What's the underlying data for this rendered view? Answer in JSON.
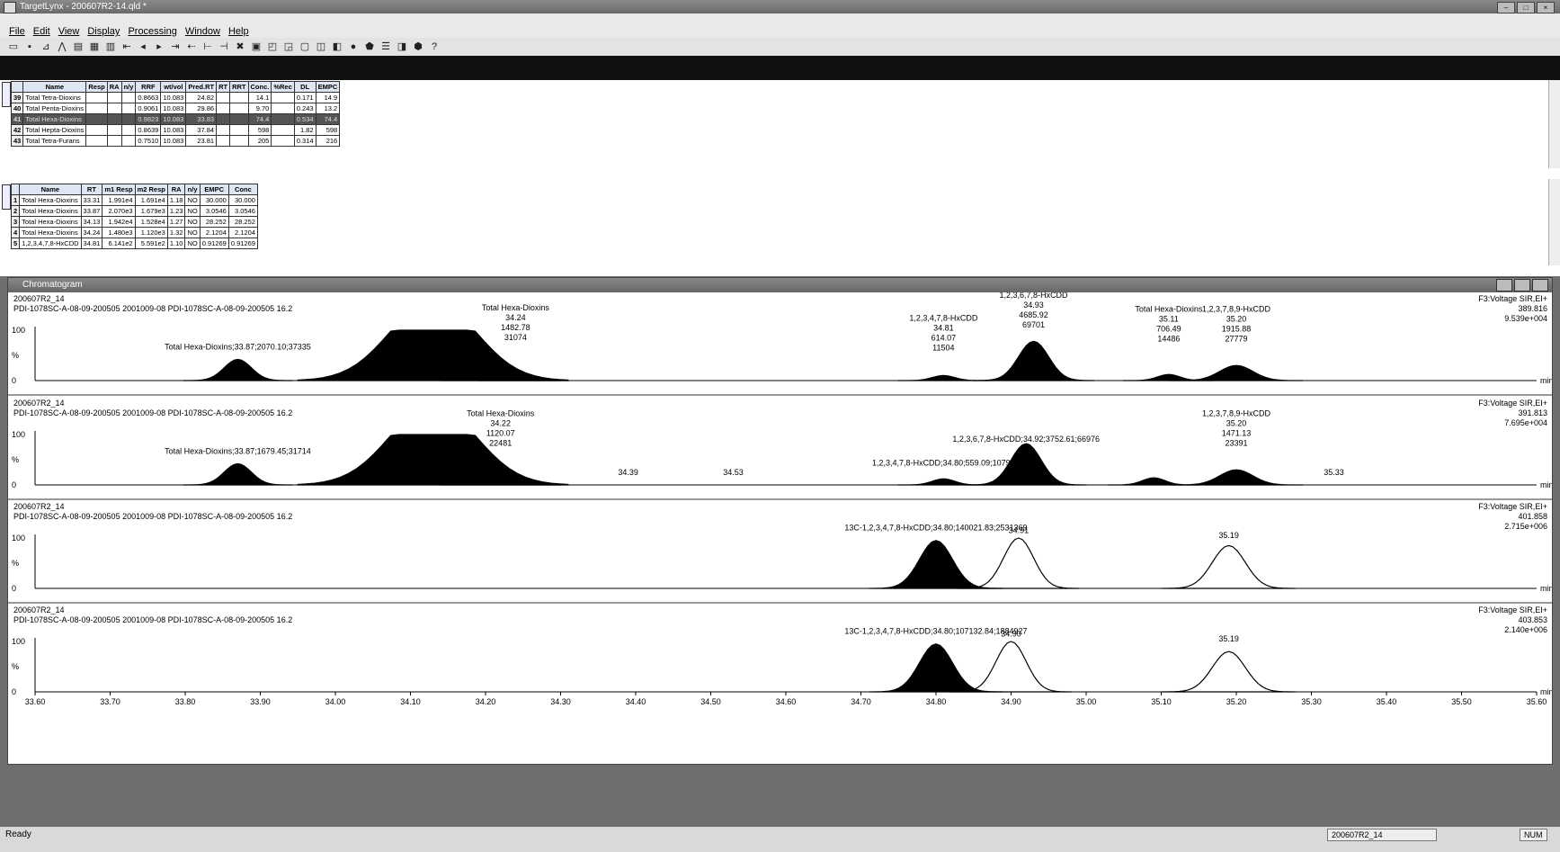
{
  "window": {
    "title": "TargetLynx - 200607R2-14.qld *",
    "menus": [
      "File",
      "Edit",
      "View",
      "Display",
      "Processing",
      "Window",
      "Help"
    ]
  },
  "summary_table": {
    "columns": [
      "",
      "Name",
      "Resp",
      "RA",
      "n/y",
      "RRF",
      "wt/vol",
      "Pred.RT",
      "RT",
      "RRT",
      "Conc.",
      "%Rec",
      "DL",
      "EMPC"
    ],
    "rows": [
      [
        "39",
        "Total Tetra-Dioxins",
        "",
        "",
        "",
        "0.8663",
        "10.083",
        "24.82",
        "",
        "",
        "14.1",
        "",
        "0.171",
        "14.9"
      ],
      [
        "40",
        "Total Penta-Dioxins",
        "",
        "",
        "",
        "0.9061",
        "10.083",
        "29.86",
        "",
        "",
        "9.70",
        "",
        "0.243",
        "13.2"
      ],
      [
        "41",
        "Total Hexa-Dioxins",
        "",
        "",
        "",
        "0.9823",
        "10.083",
        "33.83",
        "",
        "",
        "74.4",
        "",
        "0.534",
        "74.4"
      ],
      [
        "42",
        "Total Hepta-Dioxins",
        "",
        "",
        "",
        "0.8639",
        "10.083",
        "37.84",
        "",
        "",
        "598",
        "",
        "1.82",
        "598"
      ],
      [
        "43",
        "Total Tetra-Furans",
        "",
        "",
        "",
        "0.7510",
        "10.083",
        "23.81",
        "",
        "",
        "205",
        "",
        "0.314",
        "216"
      ]
    ]
  },
  "peak_table": {
    "columns": [
      "",
      "Name",
      "RT",
      "m1 Resp",
      "m2 Resp",
      "RA",
      "n/y",
      "EMPC",
      "Conc"
    ],
    "rows": [
      [
        "1",
        "Total Hexa-Dioxins",
        "33.31",
        "1.991e4",
        "1.691e4",
        "1.18",
        "NO",
        "30.000",
        "30.000"
      ],
      [
        "2",
        "Total Hexa-Dioxins",
        "33.87",
        "2.070e3",
        "1.679e3",
        "1.23",
        "NO",
        "3.0546",
        "3.0546"
      ],
      [
        "3",
        "Total Hexa-Dioxins",
        "34.13",
        "1.942e4",
        "1.528e4",
        "1.27",
        "NO",
        "28.252",
        "28.252"
      ],
      [
        "4",
        "Total Hexa-Dioxins",
        "34.24",
        "1.480e3",
        "1.120e3",
        "1.32",
        "NO",
        "2.1204",
        "2.1204"
      ],
      [
        "5",
        "1,2,3,4,7,8-HxCDD",
        "34.81",
        "6.141e2",
        "5.591e2",
        "1.10",
        "NO",
        "0.91269",
        "0.91269"
      ]
    ]
  },
  "chromatogram": {
    "window_title": "Chromatogram",
    "x_axis": {
      "ticks": [
        "33.60",
        "33.70",
        "33.80",
        "33.90",
        "34.00",
        "34.10",
        "34.20",
        "34.30",
        "34.40",
        "34.50",
        "34.60",
        "34.70",
        "34.80",
        "34.90",
        "35.00",
        "35.10",
        "35.20",
        "35.30",
        "35.40",
        "35.50",
        "35.60"
      ],
      "unit": "min"
    },
    "panels": [
      {
        "sample": "200607R2_14",
        "description": "PDI-1078SC-A-08-09-200505 2001009-08 PDI-1078SC-A-08-09-200505 16.2",
        "function": "F3:Voltage SIR,EI+",
        "mass": "389.816",
        "intensity": "9.539e+004",
        "y_ticks": [
          "100",
          "%",
          "0"
        ],
        "labels": [
          {
            "lines": [
              "Total Hexa-Dioxins;33.87;2070.10;37335"
            ]
          },
          {
            "lines": [
              "Total Hexa-Dioxins",
              "34.24",
              "1482.78",
              "31074"
            ]
          },
          {
            "lines": [
              "1,2,3,4,7,8-HxCDD",
              "34.81",
              "614.07",
              "11504"
            ]
          },
          {
            "lines": [
              "1,2,3,6,7,8-HxCDD",
              "34.93",
              "4685.92",
              "69701"
            ]
          },
          {
            "lines": [
              "Total Hexa-Dioxins",
              "35.11",
              "706.49",
              "14486"
            ]
          },
          {
            "lines": [
              "1,2,3,7,8,9-HxCDD",
              "35.20",
              "1915.88",
              "27779"
            ]
          }
        ]
      },
      {
        "sample": "200607R2_14",
        "description": "PDI-1078SC-A-08-09-200505 2001009-08 PDI-1078SC-A-08-09-200505 16.2",
        "function": "F3:Voltage SIR,EI+",
        "mass": "391.813",
        "intensity": "7.695e+004",
        "y_ticks": [
          "100",
          "%",
          "0"
        ],
        "labels": [
          {
            "lines": [
              "Total Hexa-Dioxins;33.87;1679.45;31714"
            ]
          },
          {
            "lines": [
              "Total Hexa-Dioxins",
              "34.22",
              "1120.07",
              "22481"
            ]
          },
          {
            "lines": [
              "34.39"
            ]
          },
          {
            "lines": [
              "34.53"
            ]
          },
          {
            "lines": [
              "1,2,3,4,7,8-HxCDD;34.80;559.09;10799"
            ]
          },
          {
            "lines": [
              "1,2,3,6,7,8-HxCDD;34.92;3752.61;66976"
            ]
          },
          {
            "lines": [
              "1,2,3,7,8,9-HxCDD",
              "35.20",
              "1471.13",
              "23391"
            ]
          },
          {
            "lines": [
              "35.33"
            ]
          }
        ]
      },
      {
        "sample": "200607R2_14",
        "description": "PDI-1078SC-A-08-09-200505 2001009-08 PDI-1078SC-A-08-09-200505 16.2",
        "function": "F3:Voltage SIR,EI+",
        "mass": "401.858",
        "intensity": "2.715e+006",
        "y_ticks": [
          "100",
          "%",
          "0"
        ],
        "labels": [
          {
            "lines": [
              "13C-1,2,3,4,7,8-HxCDD;34.80;140021.83;2531369"
            ]
          },
          {
            "lines": [
              "34.91"
            ]
          },
          {
            "lines": [
              "35.19"
            ]
          }
        ]
      },
      {
        "sample": "200607R2_14",
        "description": "PDI-1078SC-A-08-09-200505 2001009-08 PDI-1078SC-A-08-09-200505 16.2",
        "function": "F3:Voltage SIR,EI+",
        "mass": "403.853",
        "intensity": "2.140e+006",
        "y_ticks": [
          "100",
          "%",
          "0"
        ],
        "labels": [
          {
            "lines": [
              "13C-1,2,3,4,7,8-HxCDD;34.80;107132.84;1884927"
            ]
          },
          {
            "lines": [
              "34.90"
            ]
          },
          {
            "lines": [
              "35.19"
            ]
          }
        ]
      }
    ]
  },
  "status": {
    "ready": "Ready",
    "sample": "200607R2_14",
    "num": "NUM"
  }
}
